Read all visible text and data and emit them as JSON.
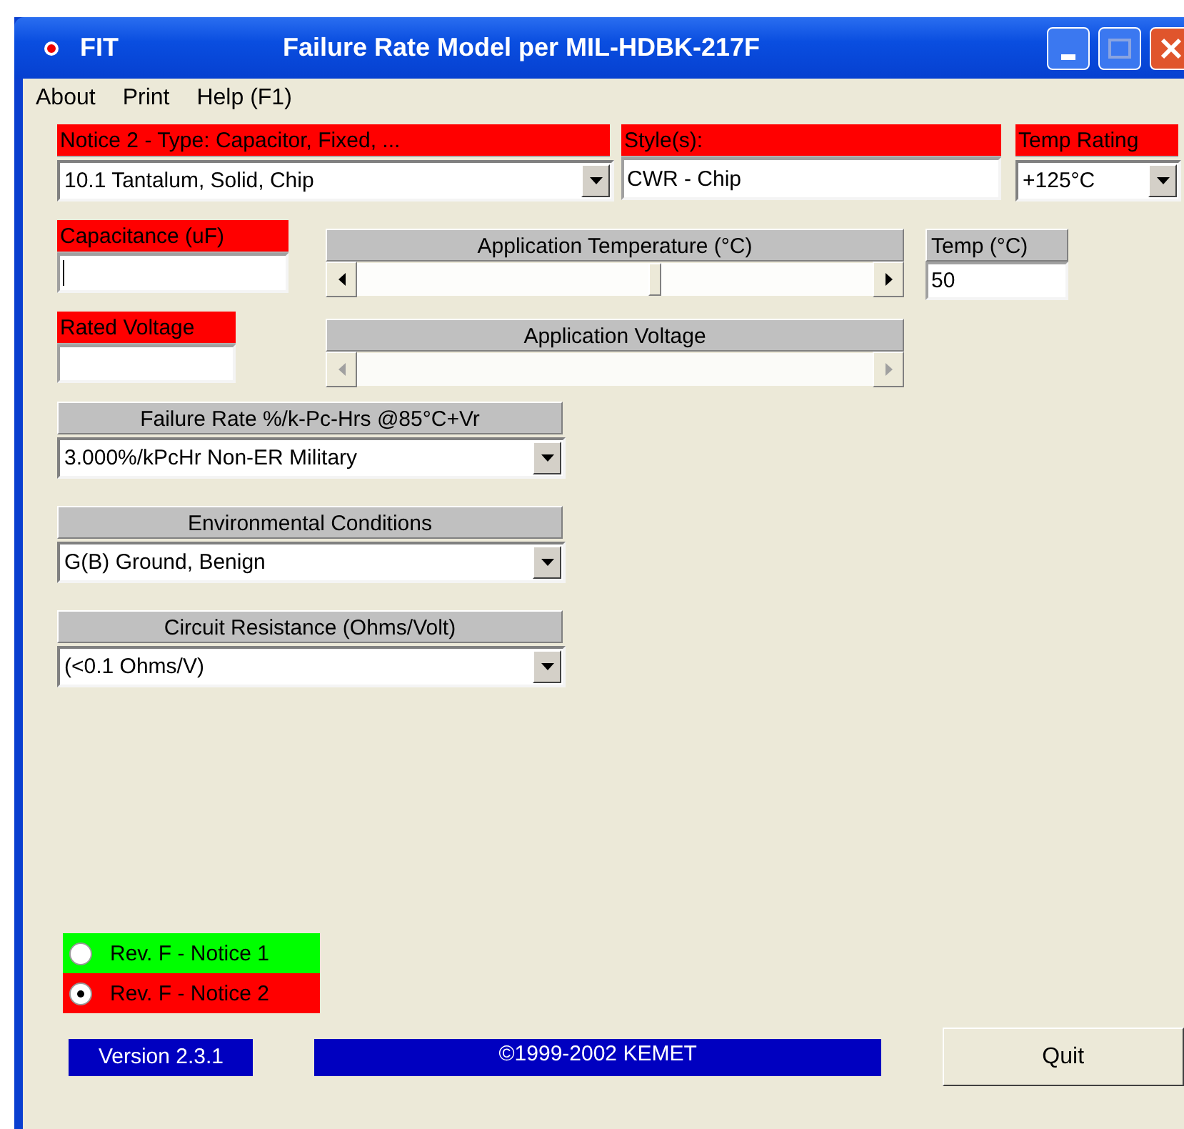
{
  "window": {
    "app_name": "FIT",
    "title": "Failure Rate Model per MIL-HDBK-217F"
  },
  "menu": [
    {
      "label": "About"
    },
    {
      "label": "Print"
    },
    {
      "label": "Help (F1)"
    }
  ],
  "type": {
    "label": "Notice 2 - Type: Capacitor, Fixed, ...",
    "value": "10.1 Tantalum, Solid, Chip"
  },
  "style": {
    "label": "Style(s):",
    "value": "CWR - Chip"
  },
  "temp_rating": {
    "label": "Temp Rating",
    "value": "+125°C"
  },
  "capacitance": {
    "label": "Capacitance (uF)",
    "focused": true
  },
  "application_temperature": {
    "label": "Application Temperature (°C)",
    "disabled": false
  },
  "temp": {
    "label": "Temp (°C)",
    "value": "50"
  },
  "rated_voltage": {
    "label": "Rated Voltage"
  },
  "application_voltage": {
    "label": "Application Voltage",
    "disabled": true
  },
  "dropdowns": [
    {
      "label": "Failure Rate %/k-Pc-Hrs @85°C+Vr",
      "value": "3.000%/kPcHr Non-ER Military"
    },
    {
      "label": "Environmental Conditions",
      "value": "G(B)  Ground, Benign"
    },
    {
      "label": "Circuit Resistance (Ohms/Volt)",
      "value": "(<0.1 Ohms/V)"
    }
  ],
  "revisions": [
    {
      "label": "Rev. F - Notice 1",
      "selected": false,
      "color": "#00ff00"
    },
    {
      "label": "Rev. F - Notice 2",
      "selected": true,
      "color": "#ff0000"
    }
  ],
  "version": "Version 2.3.1",
  "copyright": "©1999-2002 KEMET",
  "buttons": [
    {
      "label": "Quit"
    }
  ]
}
